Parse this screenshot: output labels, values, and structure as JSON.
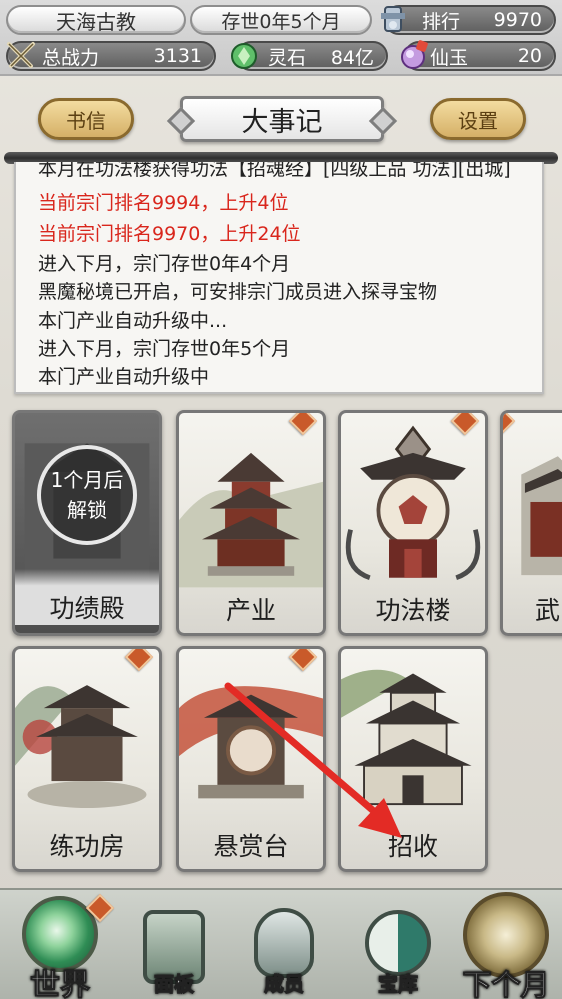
{
  "top_bar": {
    "sect_name": "天海古教",
    "sect_age": "存世0年5个月",
    "rank_label": "排行",
    "rank_value": "9970",
    "power_label": "总战力",
    "power_value": "3131",
    "spirit_stone_label": "灵石",
    "spirit_stone_value": "84亿",
    "jade_label": "仙玉",
    "jade_value": "20"
  },
  "header": {
    "letters_button": "书信",
    "title": "大事记",
    "settings_button": "设置"
  },
  "log": {
    "lines": [
      {
        "text": "本月在功法楼获得功法【招魂经】[四级上品 功法][出城]",
        "color": "normal"
      },
      {
        "text": "当前宗门排名9994，上升4位",
        "color": "red"
      },
      {
        "text": "当前宗门排名9970，上升24位",
        "color": "red"
      },
      {
        "text": "进入下月，宗门存世0年4个月",
        "color": "normal"
      },
      {
        "text": "黑魔秘境已开启，可安排宗门成员进入探寻宝物",
        "color": "normal"
      },
      {
        "text": "本门产业自动升级中...",
        "color": "normal"
      },
      {
        "text": "进入下月，宗门存世0年5个月",
        "color": "normal"
      },
      {
        "text": "本门产业自动升级中",
        "color": "normal"
      }
    ]
  },
  "buildings": [
    {
      "name": "功绩殿",
      "locked": true,
      "lock_text_1": "1个月后",
      "lock_text_2": "解锁",
      "badge": false
    },
    {
      "name": "产业",
      "locked": false,
      "badge": true
    },
    {
      "name": "功法楼",
      "locked": false,
      "badge": true
    },
    {
      "name": "武",
      "locked": false,
      "badge": true
    },
    {
      "name": "练功房",
      "locked": false,
      "badge": true
    },
    {
      "name": "悬赏台",
      "locked": false,
      "badge": true
    },
    {
      "name": "招收",
      "locked": false,
      "badge": false
    }
  ],
  "bottom_nav": [
    {
      "label": "世界",
      "icon": "world-icon",
      "badge": true
    },
    {
      "label": "面板",
      "icon": "panel-scroll-icon",
      "badge": false
    },
    {
      "label": "成员",
      "icon": "member-icon",
      "badge": false
    },
    {
      "label": "宝库",
      "icon": "treasury-icon",
      "badge": false
    },
    {
      "label": "下个月",
      "icon": "next-month-icon",
      "badge": false
    }
  ],
  "colors": {
    "log_red": "#d9261c",
    "button_gold": "#d5b067",
    "badge_orange": "#c95a2a",
    "annotation_arrow": "#e32b25"
  },
  "annotation": {
    "type": "arrow",
    "target": "招收"
  }
}
